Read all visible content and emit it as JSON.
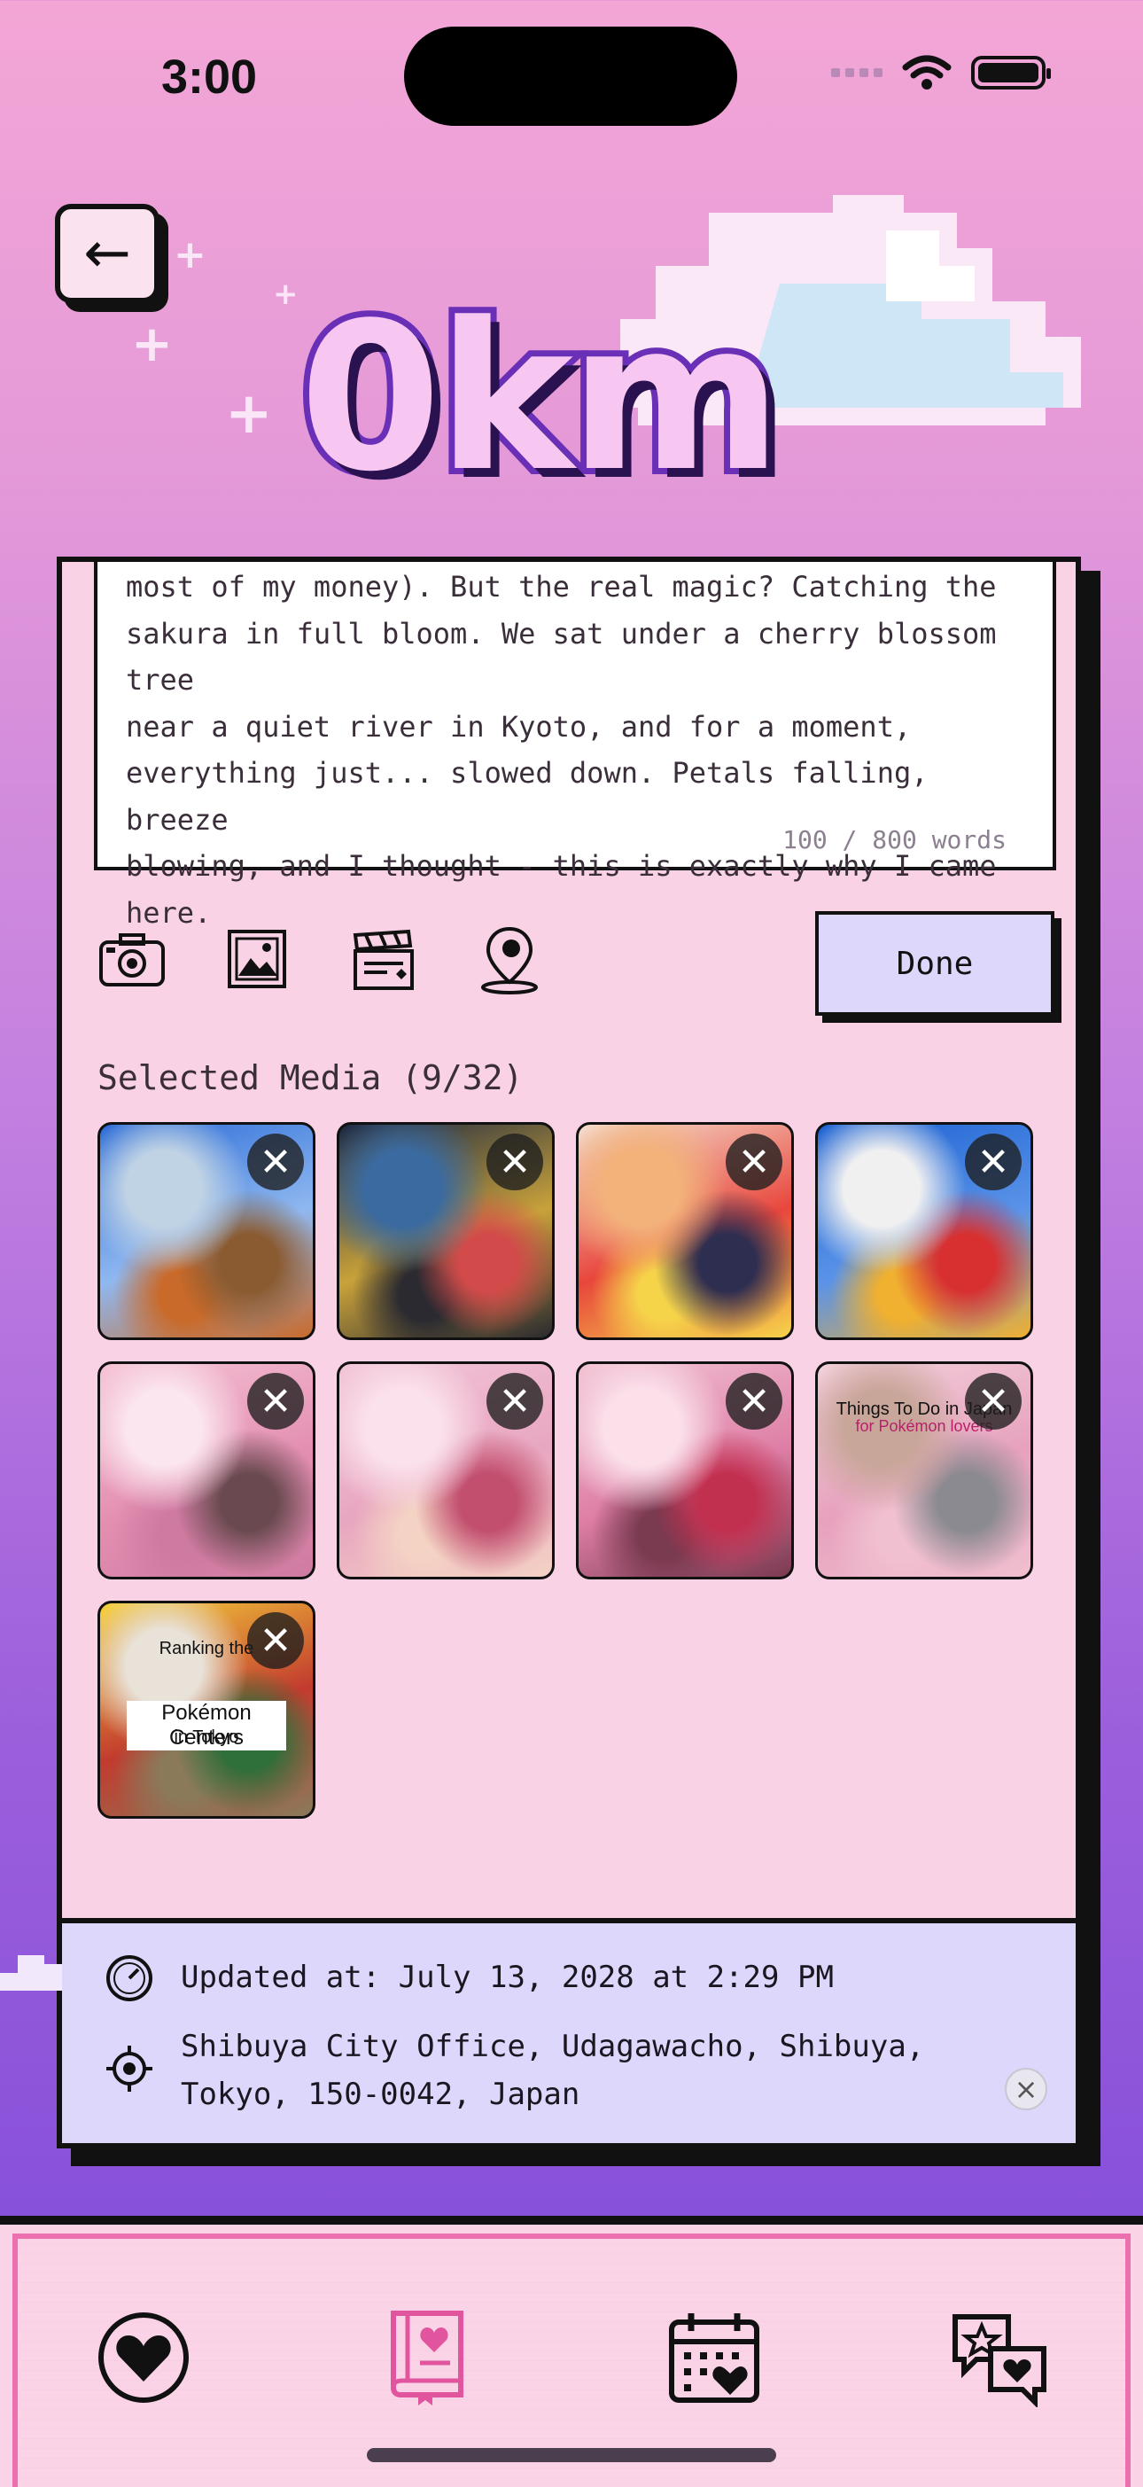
{
  "status_bar": {
    "time": "3:00"
  },
  "header": {
    "back_icon": "arrow-left-icon",
    "distance": "0km"
  },
  "journal": {
    "text": "most of my money). But the real magic? Catching the\nsakura in full bloom. We sat under a cherry blossom tree\nnear a quiet river in Kyoto, and for a moment,\neverything just... slowed down. Petals falling, breeze\nblowing, and I thought - this is exactly why I came here.",
    "word_count": "100 / 800 words"
  },
  "toolbar": {
    "tools": [
      "camera-icon",
      "gallery-icon",
      "clapperboard-icon",
      "location-pin-icon"
    ],
    "done_label": "Done"
  },
  "media": {
    "heading": "Selected Media (9/32)",
    "items": [
      {
        "name": "mount-fuji-pagoda",
        "colors": [
          "#2a6ad6",
          "#8fb8f0",
          "#c0d3e5",
          "#8a5a30",
          "#c96a2a"
        ]
      },
      {
        "name": "tokyo-street-night",
        "colors": [
          "#1a2640",
          "#c9a23a",
          "#3a6aa0",
          "#d24a4a",
          "#2a2a30"
        ]
      },
      {
        "name": "one-piece-poster",
        "colors": [
          "#f4e0d0",
          "#e8463c",
          "#f3b27a",
          "#2e2e50",
          "#f6d44a"
        ]
      },
      {
        "name": "gundam-statue",
        "colors": [
          "#1b61d2",
          "#5a93e8",
          "#f0f0f0",
          "#d83030",
          "#f0b030"
        ]
      },
      {
        "name": "cherry-blossoms",
        "colors": [
          "#f5c3d5",
          "#e48fb2",
          "#fbe5ee",
          "#6a4a50",
          "#cf7aa0"
        ]
      },
      {
        "name": "kimono-woman-blossoms",
        "colors": [
          "#f2c6d8",
          "#e8a6c0",
          "#fbe1ec",
          "#c24f6e",
          "#f4d2c4"
        ]
      },
      {
        "name": "kimono-parasol-back",
        "colors": [
          "#f2c4d4",
          "#de7ea6",
          "#fbe0ea",
          "#c23050",
          "#7a3a50"
        ]
      },
      {
        "name": "pink-blob-building",
        "colors": [
          "#f3d2dc",
          "#e7a1bd",
          "#c9a69a",
          "#8a8a90",
          "#f0c0d0"
        ],
        "overlay_top": "Things To Do in Japan",
        "overlay_sub": "for Pokémon lovers"
      },
      {
        "name": "pikachu-pokemon-center",
        "colors": [
          "#f6d23a",
          "#c23b2e",
          "#e8e2d8",
          "#2f6f3a",
          "#8a7a5a"
        ],
        "overlay_top": "Ranking the",
        "overlay_mid": "Pokémon Centers",
        "overlay_bot": "in Tokyo"
      }
    ]
  },
  "info": {
    "updated": "Updated at: July 13, 2028 at 2:29 PM",
    "location": "Shibuya City Office, Udagawacho, Shibuya,\nTokyo, 150-0042, Japan"
  },
  "tabbar": {
    "tabs": [
      "heart-icon",
      "journal-book-icon",
      "calendar-heart-icon",
      "chat-star-icon"
    ],
    "active": "journal-book-icon"
  },
  "colors": {
    "accent_purple": "#6a2fb7",
    "card_pink": "#fad2e5",
    "panel_lavender": "#dcd7fb",
    "tab_pink": "#ec6fb0"
  }
}
